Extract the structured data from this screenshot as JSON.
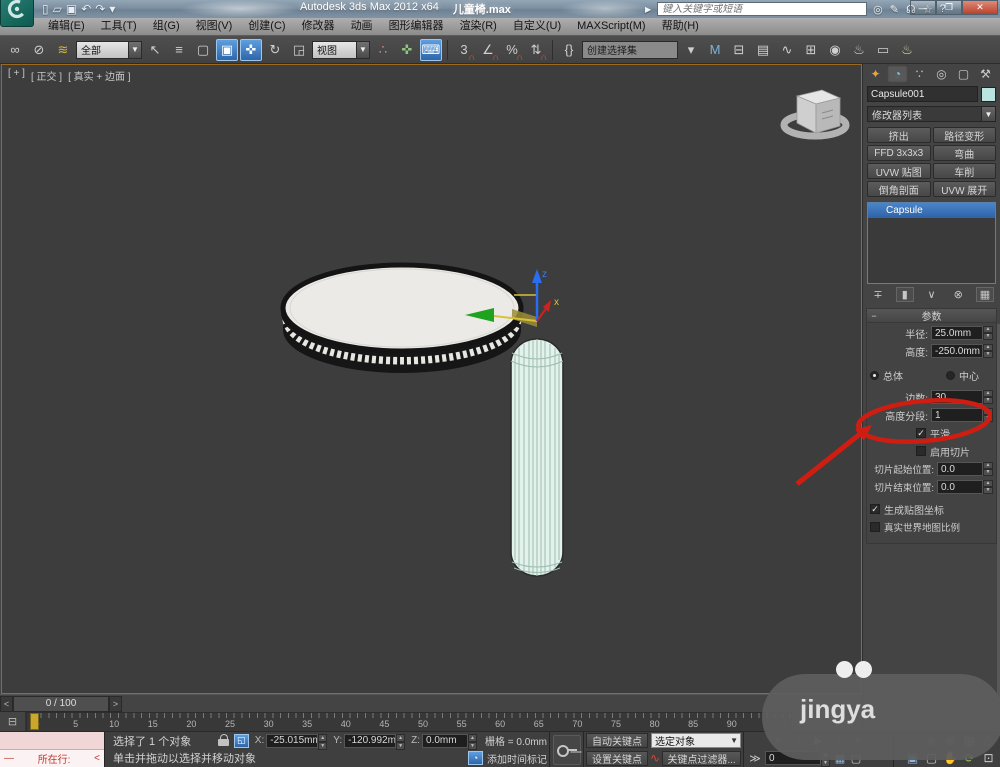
{
  "titlebar": {
    "app_title": "Autodesk 3ds Max  2012 x64",
    "doc_title": "儿童椅.max",
    "search_placeholder": "键入关键字或短语",
    "quick_access": [
      {
        "name": "new-file-icon",
        "glyph": "▯"
      },
      {
        "name": "open-file-icon",
        "glyph": "▱"
      },
      {
        "name": "save-file-icon",
        "glyph": "▣"
      },
      {
        "name": "undo-icon",
        "glyph": "↶"
      },
      {
        "name": "redo-icon",
        "glyph": "↷"
      },
      {
        "name": "toolbar-options-icon",
        "glyph": "▾"
      }
    ],
    "right_icons": [
      {
        "name": "search-icon",
        "glyph": "◎"
      },
      {
        "name": "pen-icon",
        "glyph": "✎"
      },
      {
        "name": "communication-center-icon",
        "glyph": "☊"
      },
      {
        "name": "favorites-icon",
        "glyph": "☆"
      },
      {
        "name": "help-icon",
        "glyph": "?"
      }
    ],
    "minimize": "—",
    "maximize": "❐",
    "close": "✕"
  },
  "menubar": {
    "items": [
      "编辑(E)",
      "工具(T)",
      "组(G)",
      "视图(V)",
      "创建(C)",
      "修改器",
      "动画",
      "图形编辑器",
      "渲染(R)",
      "自定义(U)",
      "MAXScript(M)",
      "帮助(H)"
    ]
  },
  "toolbar": {
    "selection_filter": "全部",
    "reference_coord": "视图",
    "named_selection": "创建选择集",
    "icons_a": [
      {
        "name": "select-and-link-icon",
        "glyph": "∞"
      },
      {
        "name": "unlink-selection-icon",
        "glyph": "⊘"
      },
      {
        "name": "bind-to-space-warp-icon",
        "glyph": "≋",
        "color": "#d8b23a"
      }
    ],
    "icons_b": [
      {
        "name": "select-object-icon",
        "glyph": "↖"
      },
      {
        "name": "select-by-name-icon",
        "glyph": "≡"
      },
      {
        "name": "selection-region-icon",
        "glyph": "▢"
      },
      {
        "name": "window-crossing-icon",
        "glyph": "▣",
        "active": true
      },
      {
        "name": "select-and-move-icon",
        "glyph": "✜",
        "active": true
      },
      {
        "name": "select-and-rotate-icon",
        "glyph": "↻"
      },
      {
        "name": "select-and-scale-icon",
        "glyph": "◲"
      }
    ],
    "icons_c": [
      {
        "name": "use-pivot-center-icon",
        "glyph": "∴",
        "color": "#d88a7a"
      },
      {
        "name": "select-and-manipulate-icon",
        "glyph": "✜",
        "color": "#8fc77f"
      },
      {
        "name": "keyboard-override-icon",
        "glyph": "⌨",
        "active": true
      }
    ],
    "snap_icons": [
      {
        "name": "snap-3d-icon",
        "glyph": "3",
        "sub": "∩"
      },
      {
        "name": "angle-snap-icon",
        "glyph": "∠",
        "sub": "∩"
      },
      {
        "name": "percent-snap-icon",
        "glyph": "%",
        "sub": "∩"
      },
      {
        "name": "spinner-snap-icon",
        "glyph": "⇅",
        "sub": "∩"
      }
    ],
    "icons_d": [
      {
        "name": "edit-named-selections-icon",
        "glyph": "{}"
      }
    ],
    "icons_e": [
      {
        "name": "named-sets-dropdown-icon",
        "glyph": "▾"
      },
      {
        "name": "mirror-icon",
        "glyph": "M",
        "color": "#7fb2d8"
      },
      {
        "name": "align-icon",
        "glyph": "⊟"
      },
      {
        "name": "layer-manager-icon",
        "glyph": "▤"
      },
      {
        "name": "curve-editor-icon",
        "glyph": "∿"
      },
      {
        "name": "schematic-view-icon",
        "glyph": "⊞"
      },
      {
        "name": "material-editor-icon",
        "glyph": "◉"
      },
      {
        "name": "render-setup-icon",
        "glyph": "♨"
      },
      {
        "name": "rendered-frame-icon",
        "glyph": "▭"
      },
      {
        "name": "render-production-icon",
        "glyph": "♨",
        "color": "#d8d8a8"
      }
    ]
  },
  "viewport": {
    "label_menu": "[ + ]",
    "label_pov": "[ 正交 ]",
    "label_shading": "[ 真实 + 边面 ]"
  },
  "command_panel": {
    "tabs": [
      {
        "name": "tab-create",
        "glyph": "✦",
        "color": "#e8a33d"
      },
      {
        "name": "tab-modify",
        "glyph": "◔",
        "color": "#7fc3e8",
        "active": true
      },
      {
        "name": "tab-hierarchy",
        "glyph": "∵"
      },
      {
        "name": "tab-motion",
        "glyph": "◎"
      },
      {
        "name": "tab-display",
        "glyph": "▢"
      },
      {
        "name": "tab-utilities",
        "glyph": "⚒"
      }
    ],
    "object_name": "Capsule001",
    "modifier_list_label": "修改器列表",
    "modifier_buttons": [
      "挤出",
      "路径变形",
      "FFD 3x3x3",
      "弯曲",
      "UVW 贴图",
      "车削",
      "倒角剖面",
      "UVW 展开"
    ],
    "stack_selected": "Capsule",
    "stack_tools": [
      {
        "name": "pin-stack-icon",
        "glyph": "∓"
      },
      {
        "name": "show-end-result-icon",
        "glyph": "▮",
        "framed": true
      },
      {
        "name": "make-unique-icon",
        "glyph": "∨"
      },
      {
        "name": "remove-modifier-icon",
        "glyph": "⊗"
      },
      {
        "name": "configure-modifier-sets-icon",
        "glyph": "▦",
        "framed": true
      }
    ],
    "params": {
      "rollout_title": "参数",
      "radius_label": "半径:",
      "radius_value": "25.0mm",
      "height_label": "高度:",
      "height_value": "-250.0mm",
      "overall_label": "总体",
      "centers_label": "中心",
      "sides_label": "边数:",
      "sides_value": "30",
      "height_segs_label": "高度分段:",
      "height_segs_value": "1",
      "smooth_label": "平滑",
      "enable_slice_label": "启用切片",
      "slice_from_label": "切片起始位置:",
      "slice_from_value": "0.0",
      "slice_to_label": "切片结束位置:",
      "slice_to_value": "0.0",
      "gen_map_label": "生成贴图坐标",
      "real_world_label": "真实世界地图比例"
    }
  },
  "timeline": {
    "frame_display": "0 / 100",
    "prev_glyph": "<",
    "next_glyph": ">",
    "ruler_icon": "⊟",
    "ticks": [
      "0",
      "5",
      "10",
      "15",
      "20",
      "25",
      "30",
      "35",
      "40",
      "45",
      "50",
      "55",
      "60",
      "65",
      "70",
      "75",
      "80",
      "85",
      "90"
    ]
  },
  "status": {
    "selection_text": "选择了 1 个对象",
    "prompt_text": "单击并拖动以选择并移动对象",
    "line_dash": "—",
    "line_label": "所在行:",
    "line_chevron": "<",
    "x_label": "X:",
    "x_value": "-25.015mm",
    "y_label": "Y:",
    "y_value": "-120.992m",
    "z_label": "Z:",
    "z_value": "0.0mm",
    "grid_text": "栅格 = 0.0mm",
    "time_tag_label": "添加时间标记",
    "auto_key_label": "自动关键点",
    "set_key_label": "设置关键点",
    "selection_set_value": "选定对象",
    "key_filters_label": "关键点过滤器...",
    "key_nav_glyph": "≫",
    "frame_value": "0",
    "playback_icons": [
      {
        "name": "go-to-start-icon",
        "glyph": "«"
      },
      {
        "name": "previous-frame-icon",
        "glyph": "‹"
      },
      {
        "name": "play-icon",
        "glyph": "▶"
      },
      {
        "name": "next-frame-icon",
        "glyph": "›"
      },
      {
        "name": "go-to-end-icon",
        "glyph": "»"
      }
    ],
    "nav_icons_top": [
      {
        "name": "zoom-icon",
        "glyph": "⊕"
      },
      {
        "name": "zoom-all-icon",
        "glyph": "⊕"
      },
      {
        "name": "zoom-extents-all-icon",
        "glyph": "▦"
      },
      {
        "name": "fov-icon",
        "glyph": "◇"
      }
    ],
    "nav_icons_bottom": [
      {
        "name": "zoom-extents-icon",
        "glyph": "▣",
        "color": "#8fb7e0"
      },
      {
        "name": "zoom-region-icon",
        "glyph": "▢"
      },
      {
        "name": "pan-icon",
        "glyph": "✋"
      },
      {
        "name": "orbit-icon",
        "glyph": "⟳",
        "color": "#9ec75a"
      },
      {
        "name": "maximize-viewport-icon",
        "glyph": "⊡"
      }
    ],
    "frame_field_icons": [
      {
        "name": "key-mode-icon",
        "glyph": "▦",
        "color": "#8fb7e0"
      },
      {
        "name": "selection-brackets-icon",
        "glyph": "▢"
      }
    ]
  },
  "watermark": {
    "text": "jingya"
  },
  "colors": {
    "accent_blue": "#2f66a8",
    "annotation_red": "#cf1d12",
    "capsule_fill": "#e4f2ec",
    "object_swatch": "#b9e4df",
    "timeslider_yellow": "#c9a82d"
  }
}
